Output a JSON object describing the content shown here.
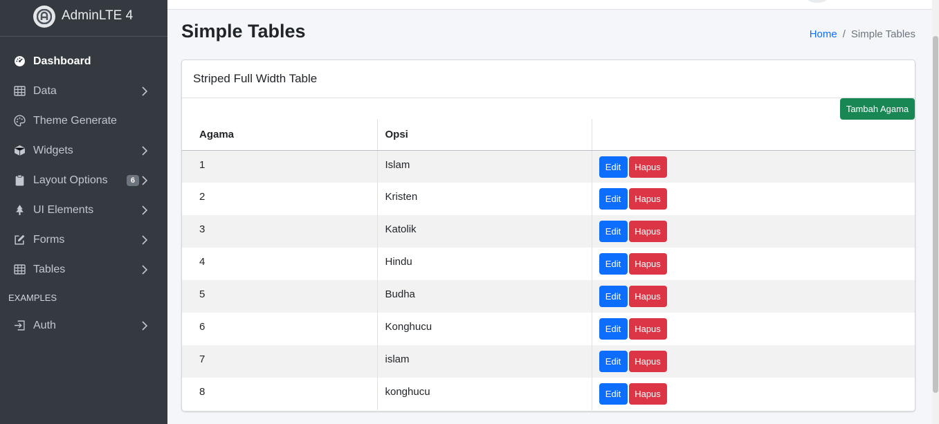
{
  "brand": {
    "name": "AdminLTE 4"
  },
  "sidebar": {
    "items": [
      {
        "label": "Dashboard",
        "icon": "speedometer-icon",
        "active": true
      },
      {
        "label": "Data",
        "icon": "table-icon",
        "has_children": true
      },
      {
        "label": "Theme Generate",
        "icon": "palette-icon"
      },
      {
        "label": "Widgets",
        "icon": "box-icon",
        "has_children": true
      },
      {
        "label": "Layout Options",
        "icon": "clipboard-icon",
        "has_children": true,
        "badge": "6"
      },
      {
        "label": "UI Elements",
        "icon": "tree-icon",
        "has_children": true
      },
      {
        "label": "Forms",
        "icon": "pencil-square-icon",
        "has_children": true
      },
      {
        "label": "Tables",
        "icon": "table-icon",
        "has_children": true
      }
    ],
    "section_header": "EXAMPLES",
    "examples": [
      {
        "label": "Auth",
        "icon": "box-arrow-in-right-icon",
        "has_children": true
      }
    ]
  },
  "header": {
    "title": "Simple Tables",
    "breadcrumb": {
      "home": "Home",
      "separator": "/",
      "current": "Simple Tables"
    }
  },
  "card": {
    "title": "Striped Full Width Table",
    "add_button": "Tambah Agama",
    "columns": [
      "Agama",
      "Opsi",
      ""
    ],
    "rows": [
      {
        "no": "1",
        "name": "Islam"
      },
      {
        "no": "2",
        "name": "Kristen"
      },
      {
        "no": "3",
        "name": "Katolik"
      },
      {
        "no": "4",
        "name": "Hindu"
      },
      {
        "no": "5",
        "name": "Budha"
      },
      {
        "no": "6",
        "name": "Konghucu"
      },
      {
        "no": "7",
        "name": "islam"
      },
      {
        "no": "8",
        "name": "konghucu"
      }
    ],
    "edit_label": "Edit",
    "delete_label": "Hapus"
  },
  "colors": {
    "sidebar_bg": "#343a40",
    "primary": "#0d6efd",
    "danger": "#dc3545",
    "success": "#198754"
  }
}
